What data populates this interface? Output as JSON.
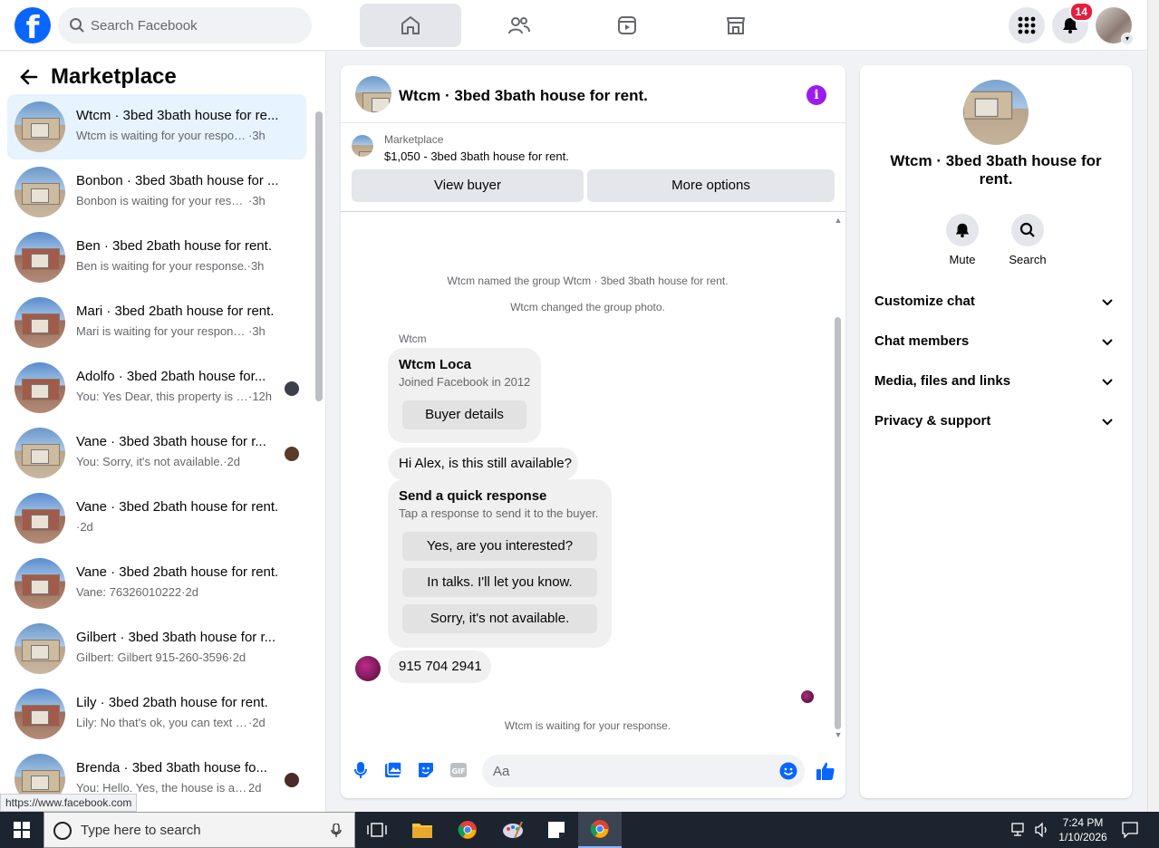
{
  "topbar": {
    "logo": "f",
    "search_placeholder": "Search Facebook",
    "notifications_count": "14"
  },
  "marketplace": {
    "title": "Marketplace",
    "conversations": [
      {
        "name": "Wtcm · 3bed 3bath house for re...",
        "snippet": "Wtcm is waiting for your response.",
        "time": "·3h"
      },
      {
        "name": "Bonbon · 3bed 3bath house for ...",
        "snippet": "Bonbon is waiting for your response.",
        "time": "·3h"
      },
      {
        "name": "Ben · 3bed 2bath house for rent.",
        "snippet": "Ben is waiting for your response.",
        "time": "·3h"
      },
      {
        "name": "Mari · 3bed 2bath house for rent.",
        "snippet": "Mari is waiting for your response.",
        "time": "·3h"
      },
      {
        "name": "Adolfo · 3bed 2bath house for...",
        "snippet": "You: Yes Dear, this property is a...",
        "time": "·12h"
      },
      {
        "name": "Vane · 3bed 3bath house for r...",
        "snippet": "You: Sorry, it's not available.",
        "time": "·2d"
      },
      {
        "name": "Vane · 3bed 2bath house for rent.",
        "snippet": "",
        "time": "·2d"
      },
      {
        "name": "Vane · 3bed 2bath house for rent.",
        "snippet": "Vane: 76326010222",
        "time": "·2d"
      },
      {
        "name": "Gilbert · 3bed 3bath house for r...",
        "snippet": "Gilbert: Gilbert 915-260-3596",
        "time": "·2d"
      },
      {
        "name": "Lily · 3bed 2bath house for rent.",
        "snippet": "Lily: No that's ok, you can text me ...",
        "time": "·2d"
      },
      {
        "name": "Brenda · 3bed 3bath house fo...",
        "snippet": "You: Hello. Yes, the house is avail...",
        "time": "2d"
      }
    ]
  },
  "status_url": "https://www.facebook.com",
  "chat": {
    "title": "Wtcm · 3bed 3bath house for rent.",
    "listing_label": "Marketplace",
    "listing_price": "$1,050 - 3bed 3bath house for rent.",
    "view_buyer": "View buyer",
    "more_options": "More options",
    "sys_named": "Wtcm named the group Wtcm · 3bed 3bath house for rent.",
    "sys_photo": "Wtcm changed the group photo.",
    "sender": "Wtcm",
    "profile_name": "Wtcm Loca",
    "profile_joined": "Joined Facebook in 2012",
    "buyer_details": "Buyer details",
    "msg_available": "Hi Alex, is this still available?",
    "quick_title": "Send a quick response",
    "quick_sub": "Tap a response to send it to the buyer.",
    "quick_responses": [
      "Yes, are you interested?",
      "In talks. I'll let you know.",
      "Sorry, it's not available."
    ],
    "msg_phone": "915 704 2941",
    "waiting": "Wtcm is waiting for your response.",
    "composer_placeholder": "Aa"
  },
  "details": {
    "title": "Wtcm · 3bed 3bath house for rent.",
    "mute": "Mute",
    "search": "Search",
    "sections": [
      "Customize chat",
      "Chat members",
      "Media, files and links",
      "Privacy & support"
    ]
  },
  "taskbar": {
    "search_placeholder": "Type here to search",
    "time": "7:24 PM",
    "date": "1/10/2026"
  },
  "colors": {
    "brand": "#0866ff",
    "info": "#9a1cf0",
    "badge": "#e41e3f",
    "selected": "#e7f3ff"
  }
}
